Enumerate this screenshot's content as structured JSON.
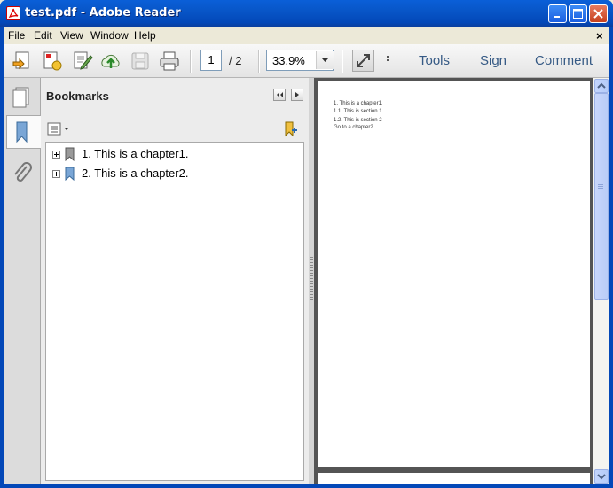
{
  "window": {
    "title": "test.pdf - Adobe Reader"
  },
  "menu": {
    "file": "File",
    "edit": "Edit",
    "view": "View",
    "window": "Window",
    "help": "Help",
    "close_doc": "×"
  },
  "toolbar": {
    "page_current": "1",
    "page_total": "/  2",
    "zoom": "33.9%",
    "tools": "Tools",
    "sign": "Sign",
    "comment": "Comment"
  },
  "bookmarks": {
    "title": "Bookmarks",
    "items": [
      {
        "label": "1. This is a chapter1."
      },
      {
        "label": "2. This is a chapter2."
      }
    ]
  },
  "document": {
    "page1_lines": [
      "1. This is a chapter1.",
      "1.1. This is section 1",
      "1.2. This is section 2",
      "Go to  a chapter2."
    ]
  },
  "colors": {
    "titlebar": "#0856c8",
    "link_text": "#365a85",
    "doc_bg": "#545454"
  }
}
